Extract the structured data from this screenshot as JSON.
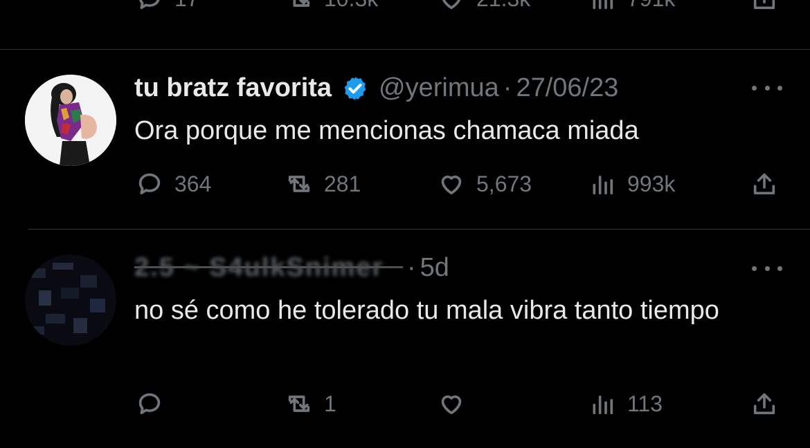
{
  "top_tweet": {
    "replies": "17",
    "retweets": "10.3k",
    "likes": "21.3k",
    "views": "791k"
  },
  "tweet1": {
    "name": "tu bratz favorita",
    "handle": "@yerimua",
    "separator": "·",
    "date": "27/06/23",
    "text": "Ora porque me mencionas chamaca miada",
    "replies": "364",
    "retweets": "281",
    "likes": "5,673",
    "views": "993k",
    "verified_color": "#1d9bf0"
  },
  "tweet2": {
    "name_obscured": "2.5 ​~ S4ulkSnimer",
    "separator": "·",
    "date": "5d",
    "text": "no sé como he tolerado tu mala vibra tanto tiempo",
    "replies": "",
    "retweets": "1",
    "likes": "",
    "views": "113"
  },
  "icons": {
    "reply": "reply-icon",
    "retweet": "retweet-icon",
    "like": "heart-icon",
    "views": "views-icon",
    "share": "share-icon",
    "more": "more-icon",
    "verified": "verified-badge-icon"
  },
  "colors": {
    "background": "#000000",
    "text": "#e7e9ea",
    "muted": "#71767b",
    "divider": "#2f3336",
    "accent": "#1d9bf0"
  }
}
